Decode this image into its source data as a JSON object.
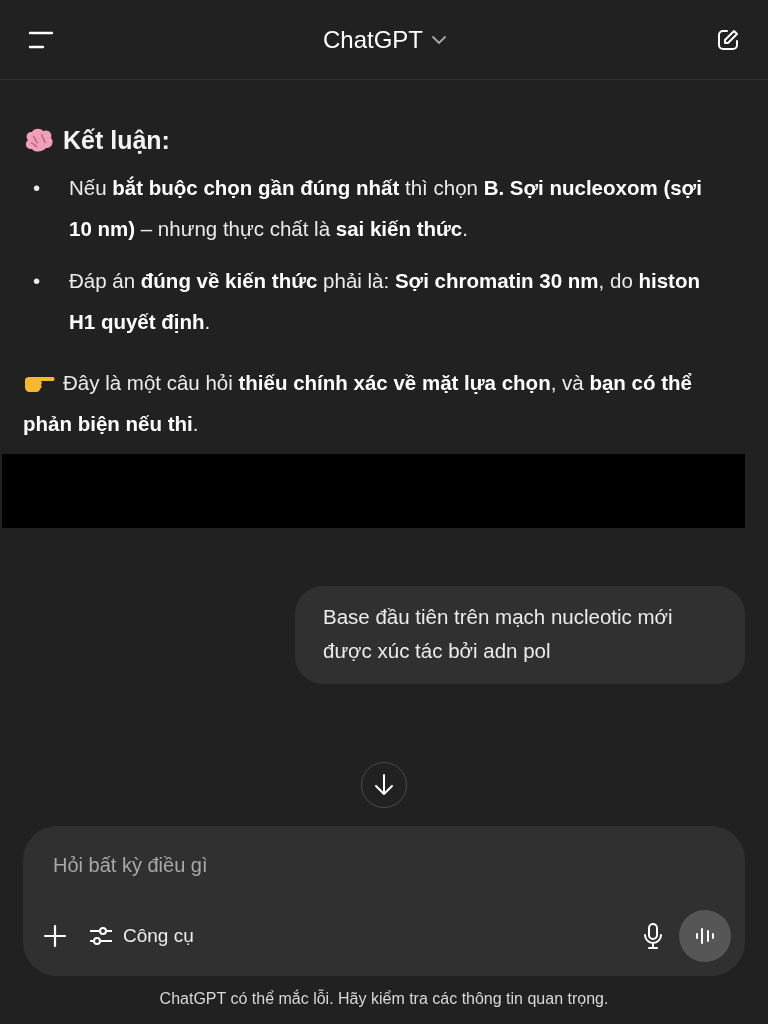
{
  "header": {
    "title": "ChatGPT"
  },
  "answer": {
    "heading": "Kết luận:",
    "bullets": [
      {
        "marker": "•",
        "text": "Nếu **bắt buộc chọn gần đúng nhất** thì chọn **B. Sợi nucleoxom (sợi 10 nm)** – nhưng thực chất là **sai kiến thức**."
      },
      {
        "marker": "•",
        "text": "Đáp án **đúng về kiến thức** phải là: **Sợi chromatin 30 nm**, do **histon H1 quyết định**."
      }
    ],
    "note": "Đây là một câu hỏi **thiếu chính xác về mặt lựa chọn**, và **bạn có thể phản biện nếu thi**."
  },
  "user_message": "Base đầu tiên trên mạch nucleotic mới được xúc tác bởi adn pol",
  "composer": {
    "placeholder": "Hỏi bất kỳ điều gì",
    "tools_label": "Công cụ"
  },
  "disclaimer": "ChatGPT có thể mắc lỗi. Hãy kiểm tra các thông tin quan trọng."
}
